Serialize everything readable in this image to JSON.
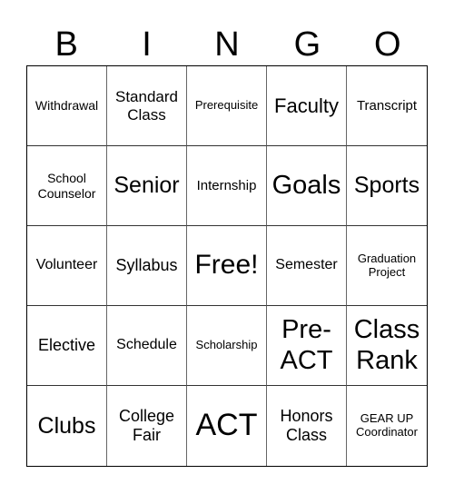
{
  "header": [
    "B",
    "I",
    "N",
    "G",
    "O"
  ],
  "cells": [
    "Withdrawal",
    "Standard Class",
    "Prerequisite",
    "Faculty",
    "Transcript",
    "School Counselor",
    "Senior",
    "Internship",
    "Goals",
    "Sports",
    "Volunteer",
    "Syllabus",
    "Free!",
    "Semester",
    "Graduation Project",
    "Elective",
    "Schedule",
    "Scholarship",
    "Pre-ACT",
    "Class Rank",
    "Clubs",
    "College Fair",
    "ACT",
    "Honors Class",
    "GEAR UP Coordinator"
  ]
}
